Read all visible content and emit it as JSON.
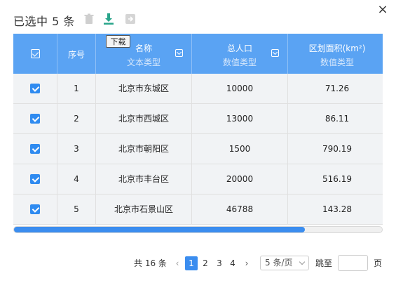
{
  "header": {
    "title": "已选中 5 条",
    "close_icon": "×",
    "tooltip": "下载"
  },
  "toolbar": {
    "icons": [
      "trash-icon",
      "download-icon",
      "export-icon"
    ],
    "accent": "#3b8def",
    "download_color": "#2aa58b"
  },
  "table": {
    "columns": [
      {
        "label": "",
        "sub": ""
      },
      {
        "label": "序号",
        "sub": ""
      },
      {
        "label": "名称",
        "sub": "文本类型"
      },
      {
        "label": "总人口",
        "sub": "数值类型"
      },
      {
        "label": "区划面积(km²)",
        "sub": "数值类型"
      }
    ],
    "rows": [
      {
        "index": "1",
        "name": "北京市东城区",
        "population": "10000",
        "area": "71.26"
      },
      {
        "index": "2",
        "name": "北京市西城区",
        "population": "13000",
        "area": "86.11"
      },
      {
        "index": "3",
        "name": "北京市朝阳区",
        "population": "1500",
        "area": "790.19"
      },
      {
        "index": "4",
        "name": "北京市丰台区",
        "population": "20000",
        "area": "516.19"
      },
      {
        "index": "5",
        "name": "北京市石景山区",
        "population": "46788",
        "area": "143.28"
      }
    ],
    "header_color": "#5aa3f3"
  },
  "scrollbar": {
    "position_fraction": 0.79
  },
  "pagination": {
    "total_text": "共 16 条",
    "prev": "‹",
    "next": "›",
    "pages": [
      "1",
      "2",
      "3",
      "4"
    ],
    "current": "1",
    "page_size": "5 条/页",
    "jump_label": "跳至",
    "jump_suffix": "页"
  }
}
